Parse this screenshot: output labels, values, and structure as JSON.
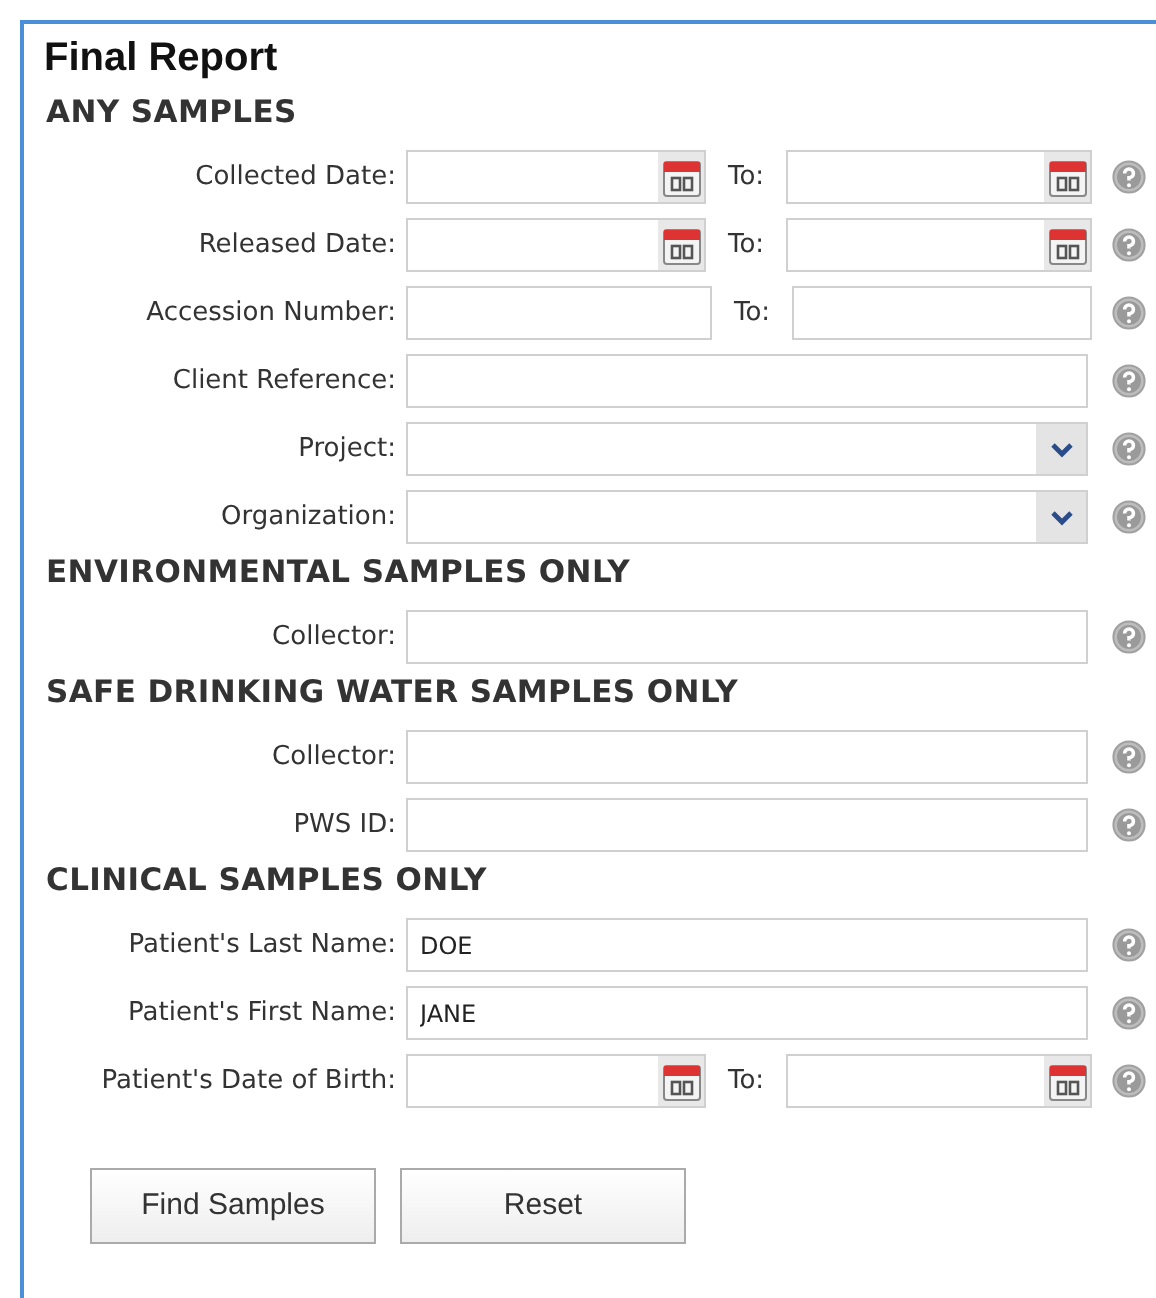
{
  "title": "Final Report",
  "sections": [
    {
      "heading": "ANY SAMPLES",
      "fields": [
        {
          "kind": "date-range",
          "label": "Collected Date:",
          "to_label": "To:"
        },
        {
          "kind": "date-range",
          "label": "Released Date:",
          "to_label": "To:"
        },
        {
          "kind": "range",
          "label": "Accession Number:",
          "to_label": "To:"
        },
        {
          "kind": "text",
          "label": "Client Reference:"
        },
        {
          "kind": "select",
          "label": "Project:"
        },
        {
          "kind": "select",
          "label": "Organization:"
        }
      ]
    },
    {
      "heading": "ENVIRONMENTAL SAMPLES ONLY",
      "fields": [
        {
          "kind": "text",
          "label": "Collector:"
        }
      ]
    },
    {
      "heading": "SAFE DRINKING WATER SAMPLES ONLY",
      "fields": [
        {
          "kind": "text",
          "label": "Collector:"
        },
        {
          "kind": "text",
          "label": "PWS ID:"
        }
      ]
    },
    {
      "heading": "CLINICAL SAMPLES ONLY",
      "fields": [
        {
          "kind": "text",
          "label": "Patient's Last Name:",
          "value": "DOE"
        },
        {
          "kind": "text",
          "label": "Patient's First Name:",
          "value": "JANE"
        },
        {
          "kind": "date-range",
          "label": "Patient's Date of Birth:",
          "to_label": "To:"
        }
      ]
    }
  ],
  "buttons": [
    "Find Samples",
    "Reset"
  ]
}
